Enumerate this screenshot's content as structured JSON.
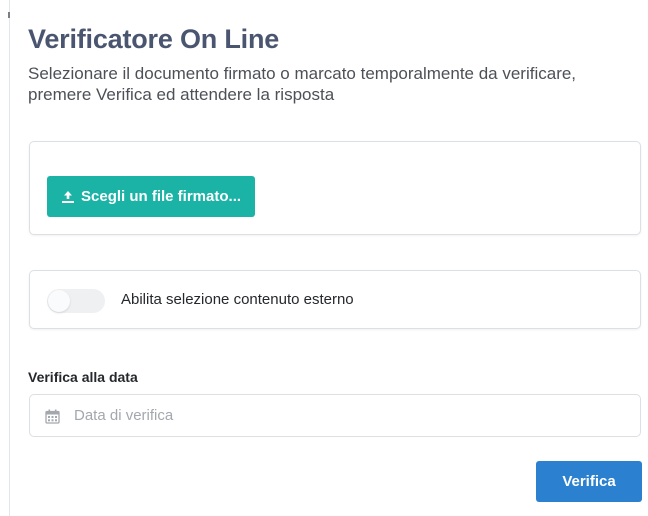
{
  "header": {
    "title": "Verificatore On Line",
    "subtitle": "Selezionare il documento firmato o marcato temporalmente da verificare, premere Verifica ed attendere la risposta"
  },
  "upload": {
    "button_label": "Scegli un file firmato...",
    "icon": "upload-icon"
  },
  "external_content": {
    "toggle_label": "Abilita selezione contenuto esterno",
    "enabled": false
  },
  "date": {
    "label": "Verifica alla data",
    "placeholder": "Data di verifica",
    "value": "",
    "icon": "calendar-icon"
  },
  "actions": {
    "verify_label": "Verifica"
  },
  "colors": {
    "title": "#4a5670",
    "upload_button": "#1ab3a6",
    "verify_button": "#2b80d0",
    "border": "#dcdfe4"
  }
}
